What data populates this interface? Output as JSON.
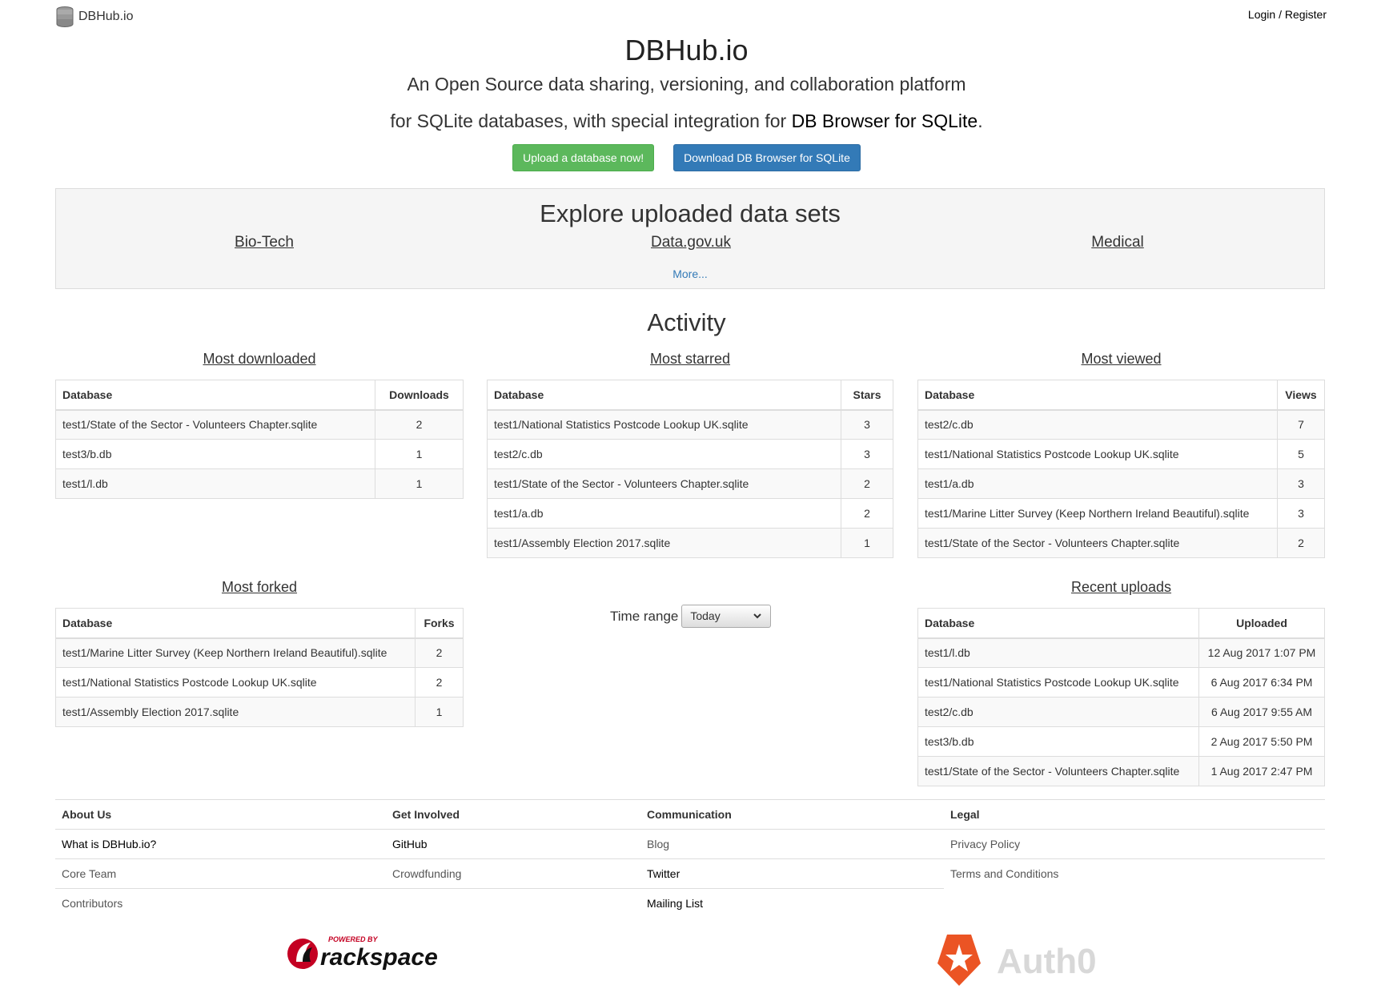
{
  "nav": {
    "brand": "DBHub.io",
    "login": "Login",
    "separator": "/",
    "register": "Register"
  },
  "hero": {
    "title": "DBHub.io",
    "tagline_line1": "An Open Source data sharing, versioning, and collaboration platform",
    "tagline_line2_prefix": "for SQLite databases, with special integration for ",
    "tagline_line2_link": "DB Browser for SQLite",
    "tagline_line2_suffix": ".",
    "upload_button": "Upload a database now!",
    "download_button": "Download DB Browser for SQLite"
  },
  "explore": {
    "title": "Explore uploaded data sets",
    "categories": [
      "Bio-Tech",
      "Data.gov.uk",
      "Medical"
    ],
    "more": "More..."
  },
  "activity": {
    "title": "Activity",
    "most_downloaded": {
      "title": "Most downloaded",
      "headers": [
        "Database",
        "Downloads"
      ],
      "rows": [
        [
          "test1/State of the Sector - Volunteers Chapter.sqlite",
          "2"
        ],
        [
          "test3/b.db",
          "1"
        ],
        [
          "test1/l.db",
          "1"
        ]
      ]
    },
    "most_starred": {
      "title": "Most starred",
      "headers": [
        "Database",
        "Stars"
      ],
      "rows": [
        [
          "test1/National Statistics Postcode Lookup UK.sqlite",
          "3"
        ],
        [
          "test2/c.db",
          "3"
        ],
        [
          "test1/State of the Sector - Volunteers Chapter.sqlite",
          "2"
        ],
        [
          "test1/a.db",
          "2"
        ],
        [
          "test1/Assembly Election 2017.sqlite",
          "1"
        ]
      ]
    },
    "most_viewed": {
      "title": "Most viewed",
      "headers": [
        "Database",
        "Views"
      ],
      "rows": [
        [
          "test2/c.db",
          "7"
        ],
        [
          "test1/National Statistics Postcode Lookup UK.sqlite",
          "5"
        ],
        [
          "test1/a.db",
          "3"
        ],
        [
          "test1/Marine Litter Survey (Keep Northern Ireland Beautiful).sqlite",
          "3"
        ],
        [
          "test1/State of the Sector - Volunteers Chapter.sqlite",
          "2"
        ]
      ]
    },
    "most_forked": {
      "title": "Most forked",
      "headers": [
        "Database",
        "Forks"
      ],
      "rows": [
        [
          "test1/Marine Litter Survey (Keep Northern Ireland Beautiful).sqlite",
          "2"
        ],
        [
          "test1/National Statistics Postcode Lookup UK.sqlite",
          "2"
        ],
        [
          "test1/Assembly Election 2017.sqlite",
          "1"
        ]
      ]
    },
    "recent_uploads": {
      "title": "Recent uploads",
      "headers": [
        "Database",
        "Uploaded"
      ],
      "rows": [
        [
          "test1/l.db",
          "12 Aug 2017 1:07 PM"
        ],
        [
          "test1/National Statistics Postcode Lookup UK.sqlite",
          "6 Aug 2017 6:34 PM"
        ],
        [
          "test2/c.db",
          "6 Aug 2017 9:55 AM"
        ],
        [
          "test3/b.db",
          "2 Aug 2017 5:50 PM"
        ],
        [
          "test1/State of the Sector - Volunteers Chapter.sqlite",
          "1 Aug 2017 2:47 PM"
        ]
      ]
    },
    "time_range": {
      "label": "Time range",
      "selected": "Today"
    }
  },
  "footer": {
    "about": {
      "heading": "About Us",
      "links": [
        "What is DBHub.io?",
        "Core Team",
        "Contributors"
      ]
    },
    "involved": {
      "heading": "Get Involved",
      "links": [
        "GitHub",
        "Crowdfunding"
      ]
    },
    "communication": {
      "heading": "Communication",
      "links": [
        "Blog",
        "Twitter",
        "Mailing List"
      ]
    },
    "legal": {
      "heading": "Legal",
      "links": [
        "Privacy Policy",
        "Terms and Conditions"
      ]
    }
  },
  "sponsors": {
    "rackspace_powered": "POWERED BY",
    "rackspace_name": "rackspace",
    "auth0_name": "Auth0"
  },
  "colors": {
    "upload_button": "#5cb85c",
    "download_button": "#337ab7",
    "link": "#337ab7",
    "rackspace_red": "#c40022",
    "auth0_orange": "#eb5424"
  },
  "icons": {
    "brand": "database-icon",
    "select": "chevron-down-icon"
  }
}
